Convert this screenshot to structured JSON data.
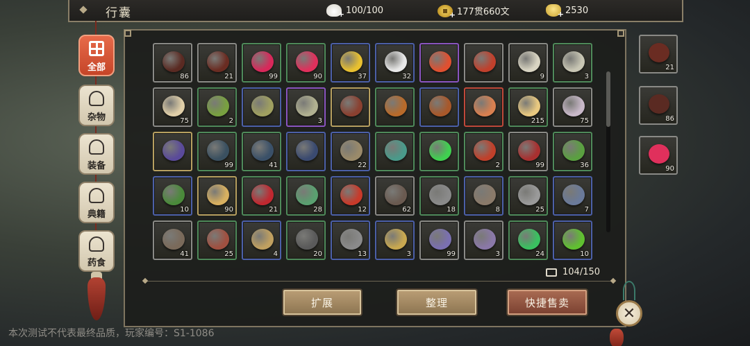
{
  "header": {
    "title": "行囊",
    "stamina": "100/100",
    "coins": "177贯660文",
    "ingots": "2530"
  },
  "tabs": [
    {
      "label": "全部",
      "icon": "grid-icon",
      "active": true
    },
    {
      "label": "杂物",
      "icon": "fan-icon",
      "active": false
    },
    {
      "label": "装备",
      "icon": "armor-icon",
      "active": false
    },
    {
      "label": "典籍",
      "icon": "book-icon",
      "active": false
    },
    {
      "label": "药食",
      "icon": "bowl-icon",
      "active": false
    }
  ],
  "inventory": {
    "items": [
      {
        "count": "86",
        "quality": "gray",
        "color": "#5a2a22"
      },
      {
        "count": "21",
        "quality": "gray",
        "color": "#6a2c22"
      },
      {
        "count": "99",
        "quality": "green",
        "color": "#d8285a"
      },
      {
        "count": "90",
        "quality": "green",
        "color": "#e0305c"
      },
      {
        "count": "37",
        "quality": "blue",
        "color": "#e8c030"
      },
      {
        "count": "32",
        "quality": "blue",
        "color": "#e8e8e8"
      },
      {
        "count": "",
        "quality": "purple",
        "color": "#e05030"
      },
      {
        "count": "",
        "quality": "gray",
        "color": "#c0402c"
      },
      {
        "count": "9",
        "quality": "gray",
        "color": "#d8d4c2"
      },
      {
        "count": "3",
        "quality": "green",
        "color": "#c8c6b4"
      },
      {
        "count": "75",
        "quality": "gray",
        "color": "#e0cfa8"
      },
      {
        "count": "2",
        "quality": "green",
        "color": "#78a040"
      },
      {
        "count": "",
        "quality": "blue",
        "color": "#a0a060"
      },
      {
        "count": "3",
        "quality": "purple",
        "color": "#b0b090"
      },
      {
        "count": "",
        "quality": "gold",
        "color": "#8a4030"
      },
      {
        "count": "",
        "quality": "green",
        "color": "#b86a2a"
      },
      {
        "count": "",
        "quality": "blue",
        "color": "#a8582a"
      },
      {
        "count": "",
        "quality": "red",
        "color": "#d88050"
      },
      {
        "count": "215",
        "quality": "green",
        "color": "#e8c880"
      },
      {
        "count": "75",
        "quality": "gray",
        "color": "#c8b8c8"
      },
      {
        "count": "",
        "quality": "gold",
        "color": "#5a4a9a"
      },
      {
        "count": "99",
        "quality": "green",
        "color": "#3a5060"
      },
      {
        "count": "41",
        "quality": "green",
        "color": "#3a5068"
      },
      {
        "count": "",
        "quality": "blue",
        "color": "#3a4a70"
      },
      {
        "count": "22",
        "quality": "blue",
        "color": "#9a8a6a"
      },
      {
        "count": "",
        "quality": "green",
        "color": "#4a9a8a"
      },
      {
        "count": "",
        "quality": "green",
        "color": "#40d050"
      },
      {
        "count": "2",
        "quality": "green",
        "color": "#c0402a"
      },
      {
        "count": "99",
        "quality": "gray",
        "color": "#a83030"
      },
      {
        "count": "36",
        "quality": "green",
        "color": "#5aa040"
      },
      {
        "count": "10",
        "quality": "blue",
        "color": "#4a8a3a"
      },
      {
        "count": "90",
        "quality": "gold",
        "color": "#d8b060"
      },
      {
        "count": "21",
        "quality": "green",
        "color": "#c02830"
      },
      {
        "count": "28",
        "quality": "green",
        "color": "#5aa070"
      },
      {
        "count": "12",
        "quality": "blue",
        "color": "#c83a2a"
      },
      {
        "count": "62",
        "quality": "gray",
        "color": "#6a5a50"
      },
      {
        "count": "18",
        "quality": "green",
        "color": "#8a8a8a"
      },
      {
        "count": "8",
        "quality": "blue",
        "color": "#8a7a6a"
      },
      {
        "count": "25",
        "quality": "green",
        "color": "#9a9a9a"
      },
      {
        "count": "7",
        "quality": "blue",
        "color": "#6a7a9a"
      },
      {
        "count": "41",
        "quality": "gray",
        "color": "#7a6a5a"
      },
      {
        "count": "25",
        "quality": "green",
        "color": "#a05040"
      },
      {
        "count": "4",
        "quality": "blue",
        "color": "#c0a060"
      },
      {
        "count": "20",
        "quality": "green",
        "color": "#5a5a5a"
      },
      {
        "count": "13",
        "quality": "blue",
        "color": "#8a8a8a"
      },
      {
        "count": "3",
        "quality": "blue",
        "color": "#c8a850"
      },
      {
        "count": "99",
        "quality": "gray",
        "color": "#7a70b0"
      },
      {
        "count": "3",
        "quality": "gray",
        "color": "#8a78a8"
      },
      {
        "count": "24",
        "quality": "green",
        "color": "#3ac060"
      },
      {
        "count": "10",
        "quality": "blue",
        "color": "#60c030"
      }
    ],
    "capacity": "104/150"
  },
  "buttons": {
    "expand": "扩展",
    "sort": "整理",
    "quick_sell": "快捷售卖"
  },
  "quick_slots": [
    {
      "count": "21",
      "color": "#6a2c22"
    },
    {
      "count": "86",
      "color": "#5a2a22"
    },
    {
      "count": "90",
      "color": "#e0305c"
    }
  ],
  "footer": {
    "note": "本次测试不代表最终品质，玩家编号：S1-1086"
  },
  "colors": {
    "accent_active_tab": "#d75535",
    "panel_border": "#7f7560",
    "button": "#a88a62"
  }
}
